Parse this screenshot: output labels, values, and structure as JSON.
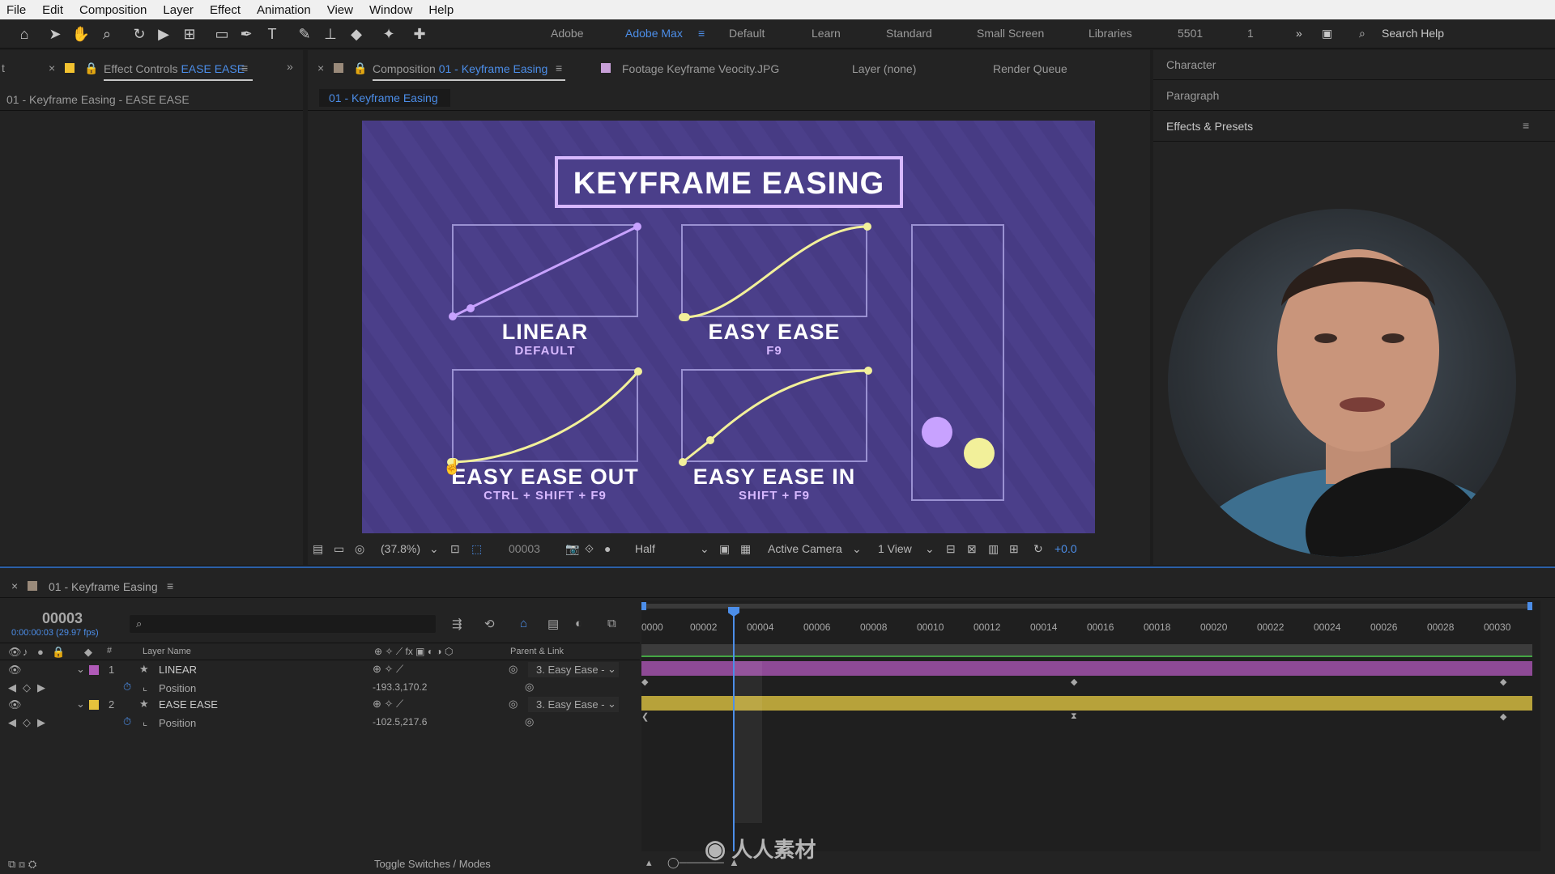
{
  "menu": [
    "File",
    "Edit",
    "Composition",
    "Layer",
    "Effect",
    "Animation",
    "View",
    "Window",
    "Help"
  ],
  "workspaces": {
    "items": [
      "Adobe",
      "Adobe Max",
      "Default",
      "Learn",
      "Standard",
      "Small Screen",
      "Libraries",
      "5501",
      "1"
    ],
    "active": "Adobe Max"
  },
  "search_help": "Search Help",
  "effect_controls": {
    "tab_prefix": "Effect Controls",
    "tab_layer": "EASE EASE",
    "subtitle": "01 - Keyframe Easing - EASE EASE",
    "left_stub": "t"
  },
  "composition_tab": {
    "prefix": "Composition",
    "name": "01 - Keyframe Easing",
    "footage_tab": "Footage Keyframe Veocity.JPG",
    "layer_tab": "Layer (none)",
    "render_tab": "Render Queue",
    "subtab": "01 - Keyframe Easing"
  },
  "right_panels": [
    "Character",
    "Paragraph",
    "Effects & Presets"
  ],
  "comp_content": {
    "title": "KEYFRAME EASING",
    "graphs": [
      {
        "label": "LINEAR",
        "sub": "DEFAULT"
      },
      {
        "label": "EASY EASE",
        "sub": "F9"
      },
      {
        "label": "EASY EASE OUT",
        "sub": "CTRL + SHIFT + F9"
      },
      {
        "label": "EASY EASE IN",
        "sub": "SHIFT + F9"
      }
    ],
    "colors": {
      "background": "#4b3f8a",
      "linear": "#c8a2ff",
      "ease": "#f2f09a",
      "panel_border": "#8f86c9"
    }
  },
  "viewer": {
    "zoom": "(37.8%)",
    "timecode": "00003",
    "resolution": "Half",
    "camera": "Active Camera",
    "views": "1 View",
    "exposure": "+0.0"
  },
  "timeline": {
    "tab": "01 - Keyframe Easing",
    "current_frame": "00003",
    "timecode_sub": "0:00:00:03 (29.97 fps)",
    "ruler": [
      "0000",
      "00002",
      "00004",
      "00006",
      "00008",
      "00010",
      "00012",
      "00014",
      "00016",
      "00018",
      "00020",
      "00022",
      "00024",
      "00026",
      "00028",
      "00030"
    ],
    "columns": {
      "layer_name": "Layer Name",
      "parent": "Parent & Link",
      "num": "#"
    },
    "layers": [
      {
        "num": "1",
        "name": "LINEAR",
        "color": "#b05ab8",
        "parent": "3. Easy Ease -",
        "prop": "Position",
        "value": "-193.3,170.2"
      },
      {
        "num": "2",
        "name": "EASE EASE",
        "color": "#e6c23c",
        "parent": "3. Easy Ease -",
        "prop": "Position",
        "value": "-102.5,217.6"
      }
    ],
    "toggle_label": "Toggle Switches / Modes"
  },
  "watermark": "人人素材"
}
